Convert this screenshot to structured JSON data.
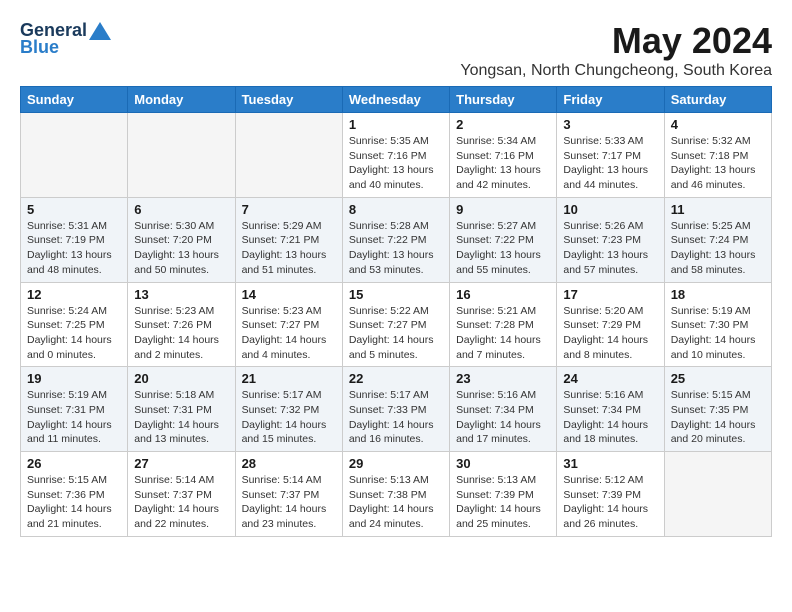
{
  "logo": {
    "general": "General",
    "blue": "Blue"
  },
  "title": {
    "month_year": "May 2024",
    "location": "Yongsan, North Chungcheong, South Korea"
  },
  "weekdays": [
    "Sunday",
    "Monday",
    "Tuesday",
    "Wednesday",
    "Thursday",
    "Friday",
    "Saturday"
  ],
  "weeks": [
    [
      {
        "day": "",
        "content": ""
      },
      {
        "day": "",
        "content": ""
      },
      {
        "day": "",
        "content": ""
      },
      {
        "day": "1",
        "content": "Sunrise: 5:35 AM\nSunset: 7:16 PM\nDaylight: 13 hours\nand 40 minutes."
      },
      {
        "day": "2",
        "content": "Sunrise: 5:34 AM\nSunset: 7:16 PM\nDaylight: 13 hours\nand 42 minutes."
      },
      {
        "day": "3",
        "content": "Sunrise: 5:33 AM\nSunset: 7:17 PM\nDaylight: 13 hours\nand 44 minutes."
      },
      {
        "day": "4",
        "content": "Sunrise: 5:32 AM\nSunset: 7:18 PM\nDaylight: 13 hours\nand 46 minutes."
      }
    ],
    [
      {
        "day": "5",
        "content": "Sunrise: 5:31 AM\nSunset: 7:19 PM\nDaylight: 13 hours\nand 48 minutes."
      },
      {
        "day": "6",
        "content": "Sunrise: 5:30 AM\nSunset: 7:20 PM\nDaylight: 13 hours\nand 50 minutes."
      },
      {
        "day": "7",
        "content": "Sunrise: 5:29 AM\nSunset: 7:21 PM\nDaylight: 13 hours\nand 51 minutes."
      },
      {
        "day": "8",
        "content": "Sunrise: 5:28 AM\nSunset: 7:22 PM\nDaylight: 13 hours\nand 53 minutes."
      },
      {
        "day": "9",
        "content": "Sunrise: 5:27 AM\nSunset: 7:22 PM\nDaylight: 13 hours\nand 55 minutes."
      },
      {
        "day": "10",
        "content": "Sunrise: 5:26 AM\nSunset: 7:23 PM\nDaylight: 13 hours\nand 57 minutes."
      },
      {
        "day": "11",
        "content": "Sunrise: 5:25 AM\nSunset: 7:24 PM\nDaylight: 13 hours\nand 58 minutes."
      }
    ],
    [
      {
        "day": "12",
        "content": "Sunrise: 5:24 AM\nSunset: 7:25 PM\nDaylight: 14 hours\nand 0 minutes."
      },
      {
        "day": "13",
        "content": "Sunrise: 5:23 AM\nSunset: 7:26 PM\nDaylight: 14 hours\nand 2 minutes."
      },
      {
        "day": "14",
        "content": "Sunrise: 5:23 AM\nSunset: 7:27 PM\nDaylight: 14 hours\nand 4 minutes."
      },
      {
        "day": "15",
        "content": "Sunrise: 5:22 AM\nSunset: 7:27 PM\nDaylight: 14 hours\nand 5 minutes."
      },
      {
        "day": "16",
        "content": "Sunrise: 5:21 AM\nSunset: 7:28 PM\nDaylight: 14 hours\nand 7 minutes."
      },
      {
        "day": "17",
        "content": "Sunrise: 5:20 AM\nSunset: 7:29 PM\nDaylight: 14 hours\nand 8 minutes."
      },
      {
        "day": "18",
        "content": "Sunrise: 5:19 AM\nSunset: 7:30 PM\nDaylight: 14 hours\nand 10 minutes."
      }
    ],
    [
      {
        "day": "19",
        "content": "Sunrise: 5:19 AM\nSunset: 7:31 PM\nDaylight: 14 hours\nand 11 minutes."
      },
      {
        "day": "20",
        "content": "Sunrise: 5:18 AM\nSunset: 7:31 PM\nDaylight: 14 hours\nand 13 minutes."
      },
      {
        "day": "21",
        "content": "Sunrise: 5:17 AM\nSunset: 7:32 PM\nDaylight: 14 hours\nand 15 minutes."
      },
      {
        "day": "22",
        "content": "Sunrise: 5:17 AM\nSunset: 7:33 PM\nDaylight: 14 hours\nand 16 minutes."
      },
      {
        "day": "23",
        "content": "Sunrise: 5:16 AM\nSunset: 7:34 PM\nDaylight: 14 hours\nand 17 minutes."
      },
      {
        "day": "24",
        "content": "Sunrise: 5:16 AM\nSunset: 7:34 PM\nDaylight: 14 hours\nand 18 minutes."
      },
      {
        "day": "25",
        "content": "Sunrise: 5:15 AM\nSunset: 7:35 PM\nDaylight: 14 hours\nand 20 minutes."
      }
    ],
    [
      {
        "day": "26",
        "content": "Sunrise: 5:15 AM\nSunset: 7:36 PM\nDaylight: 14 hours\nand 21 minutes."
      },
      {
        "day": "27",
        "content": "Sunrise: 5:14 AM\nSunset: 7:37 PM\nDaylight: 14 hours\nand 22 minutes."
      },
      {
        "day": "28",
        "content": "Sunrise: 5:14 AM\nSunset: 7:37 PM\nDaylight: 14 hours\nand 23 minutes."
      },
      {
        "day": "29",
        "content": "Sunrise: 5:13 AM\nSunset: 7:38 PM\nDaylight: 14 hours\nand 24 minutes."
      },
      {
        "day": "30",
        "content": "Sunrise: 5:13 AM\nSunset: 7:39 PM\nDaylight: 14 hours\nand 25 minutes."
      },
      {
        "day": "31",
        "content": "Sunrise: 5:12 AM\nSunset: 7:39 PM\nDaylight: 14 hours\nand 26 minutes."
      },
      {
        "day": "",
        "content": ""
      }
    ]
  ]
}
